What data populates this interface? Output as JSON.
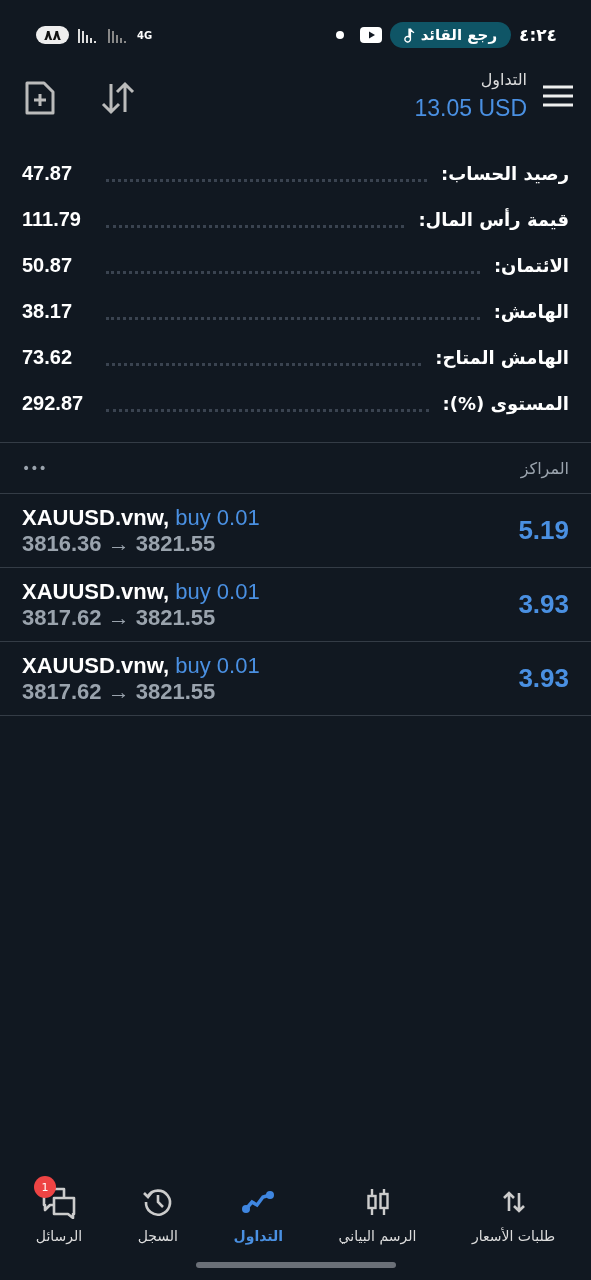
{
  "status_bar": {
    "time": "٤:٢٤",
    "now_playing": "رجع القائد",
    "network": "4G",
    "battery": "٨٨"
  },
  "header": {
    "title": "التداول",
    "balance": "13.05 USD"
  },
  "summary": [
    {
      "label": "رصيد الحساب:",
      "value": "47.87"
    },
    {
      "label": "قيمة رأس المال:",
      "value": "111.79"
    },
    {
      "label": "الائتمان:",
      "value": "50.87"
    },
    {
      "label": "الهامش:",
      "value": "38.17"
    },
    {
      "label": "الهامش المتاح:",
      "value": "73.62"
    },
    {
      "label": "المستوى (%):",
      "value": "292.87"
    }
  ],
  "positions": {
    "title": "المراكز",
    "more": "•••",
    "rows": [
      {
        "symbol": "XAUUSD.vnw,",
        "order": "buy 0.01",
        "prices": "3816.36 → 3821.55",
        "profit": "5.19"
      },
      {
        "symbol": "XAUUSD.vnw,",
        "order": "buy 0.01",
        "prices": "3817.62 → 3821.55",
        "profit": "3.93"
      },
      {
        "symbol": "XAUUSD.vnw,",
        "order": "buy 0.01",
        "prices": "3817.62 → 3821.55",
        "profit": "3.93"
      }
    ]
  },
  "nav": [
    {
      "kind": "quotes",
      "label": "طلبات الأسعار",
      "selected": false
    },
    {
      "kind": "chart",
      "label": "الرسم البياني",
      "selected": false
    },
    {
      "kind": "trade",
      "label": "التداول",
      "selected": true
    },
    {
      "kind": "history",
      "label": "السجل",
      "selected": false
    },
    {
      "kind": "messages",
      "label": "الرسائل",
      "selected": false,
      "badge": "1"
    }
  ]
}
